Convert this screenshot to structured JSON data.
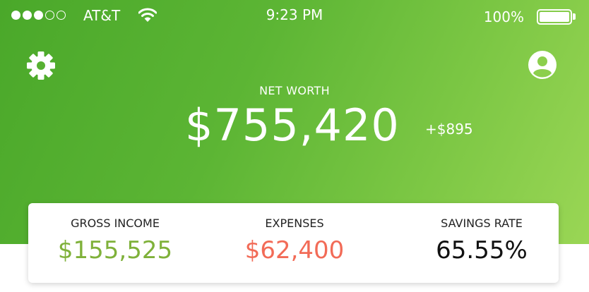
{
  "status_bar": {
    "carrier": "AT&T",
    "time": "9:23 PM",
    "battery": "100%",
    "signal_bars_filled": 3,
    "signal_bars_total": 5
  },
  "header": {
    "settings_icon": "gear-icon",
    "profile_icon": "user-circle-icon",
    "net_worth_label": "NET WORTH",
    "net_worth_value": "$755,420",
    "net_worth_change": "+$895"
  },
  "summary": {
    "gross_income": {
      "label": "GROSS INCOME",
      "value": "$155,525",
      "color": "#7fb13a"
    },
    "expenses": {
      "label": "EXPENSES",
      "value": "$62,400",
      "color": "#f26b57"
    },
    "savings_rate": {
      "label": "SAVINGS RATE",
      "value": "65.55%",
      "color": "#111111"
    }
  },
  "colors": {
    "hero_start": "#4aa82a",
    "hero_end": "#9ad655"
  }
}
